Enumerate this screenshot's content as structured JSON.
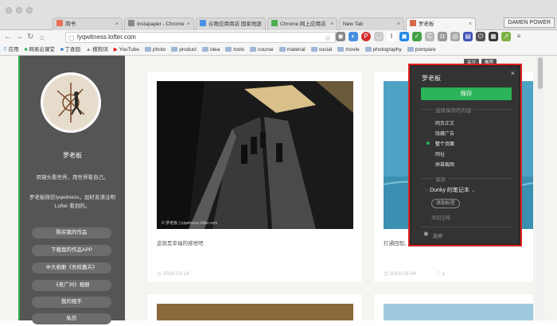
{
  "browser": {
    "tabs": [
      {
        "label": "简书",
        "active": false,
        "color": "#ea6f5a"
      },
      {
        "label": "Instapaper - Chrome",
        "active": false,
        "color": "#888888"
      },
      {
        "label": "谷歌应用商店 国家地区",
        "active": false,
        "color": "#4a90e2"
      },
      {
        "label": "Chrome 网上应用店",
        "active": false,
        "color": "#4caf50"
      },
      {
        "label": "New Tab",
        "active": false,
        "color": "#dddddd"
      },
      {
        "label": "罗老板",
        "active": true,
        "color": "#d66a48"
      }
    ],
    "profile": "DAMEN POWER",
    "url": "lyqwitness.lofter.com",
    "bookmarks": [
      "应用",
      "网易云课堂",
      "丁香园",
      "搜狗词",
      "YouTube",
      "photo",
      "product",
      "idea",
      "tools",
      "course",
      "material",
      "social",
      "movie",
      "photography",
      "pompare"
    ]
  },
  "sidebar": {
    "name": "罗老板",
    "desc1": "用镜头看世界，用世界看自己。",
    "desc2": "罗老板微信lyqwitness，加好友请注明Lofter 看到的。",
    "buttons": [
      "购买我的作品",
      "下载我的作品APP",
      "中大相册《吾校嘉卉》",
      "《老广州》相册",
      "我的相手",
      "私信"
    ]
  },
  "posts": [
    {
      "caption": "这就是幸福的感觉吧",
      "date": "2016-03-14",
      "watermark": "© 罗老板 | lyqwitness.lofter.com"
    },
    {
      "caption": "打通回程。",
      "date": "2016-03-04",
      "likes": "1"
    }
  ],
  "topbar": {
    "btn1": "关注",
    "btn2": "推荐"
  },
  "popup": {
    "title": "罗老板",
    "save": "保存",
    "section_content": "选择保存的内容",
    "options": [
      "网页正文",
      "隐藏广告",
      "整个页面",
      "网址",
      "屏幕截图"
    ],
    "selected": "整个页面",
    "section_notebook": "保存",
    "notebook": "Dunky 的笔记本",
    "tag_add": "添加标签",
    "comment": "添加注释",
    "settings": "选项"
  },
  "accent": "#2ab358"
}
